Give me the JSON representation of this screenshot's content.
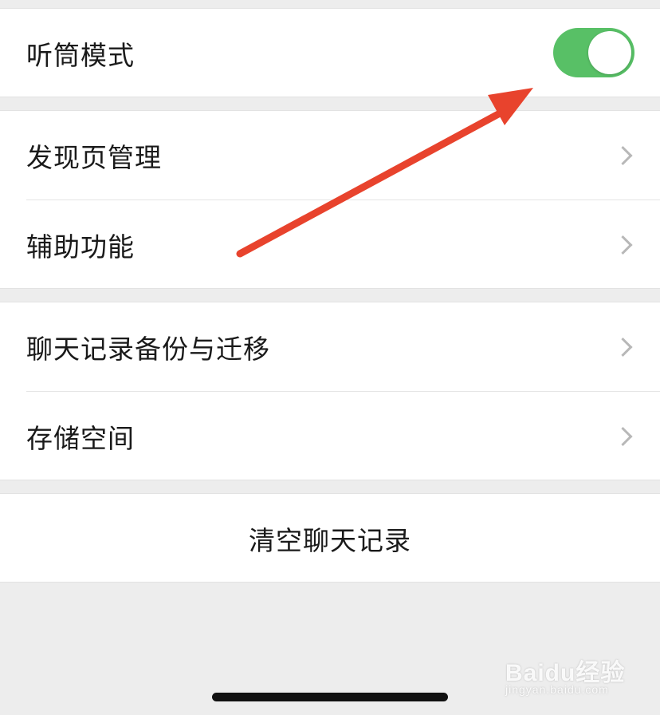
{
  "settings": {
    "earpiece_mode": {
      "label": "听筒模式",
      "enabled": true,
      "accent": "#58c066"
    },
    "discover_management": {
      "label": "发现页管理"
    },
    "accessibility": {
      "label": "辅助功能"
    },
    "chat_backup": {
      "label": "聊天记录备份与迁移"
    },
    "storage": {
      "label": "存储空间"
    },
    "clear_history": {
      "label": "清空聊天记录"
    }
  },
  "annotation": {
    "arrow_color": "#e8432d"
  },
  "watermark": {
    "logo": "Baidu经验",
    "url": "jingyan.baidu.com"
  }
}
